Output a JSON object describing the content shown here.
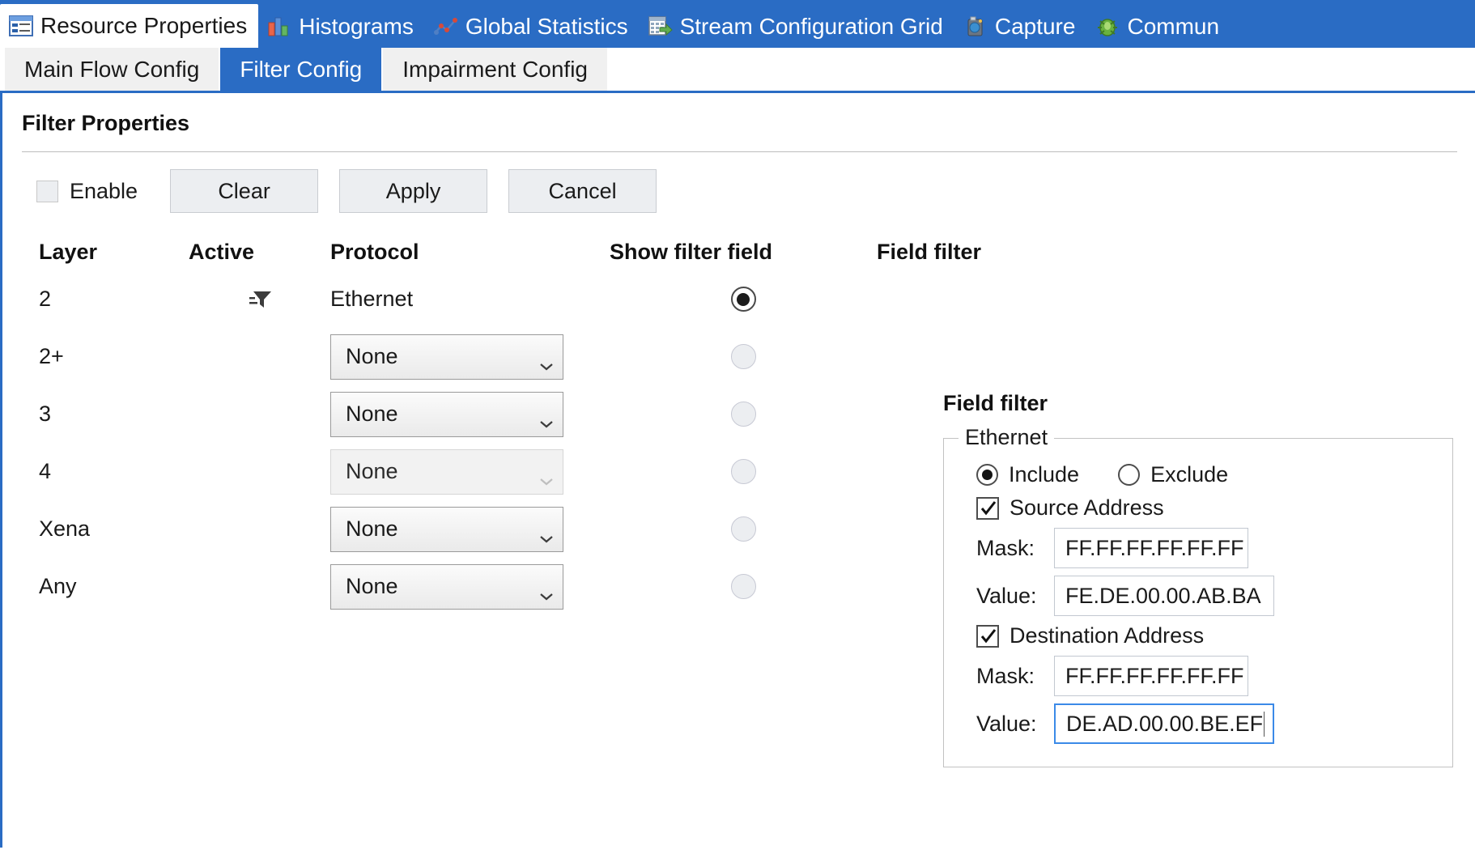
{
  "tabs": [
    {
      "label": "Resource Properties",
      "icon": "resource-properties-icon",
      "active": true
    },
    {
      "label": "Histograms",
      "icon": "histograms-icon",
      "active": false
    },
    {
      "label": "Global Statistics",
      "icon": "global-statistics-icon",
      "active": false
    },
    {
      "label": "Stream Configuration Grid",
      "icon": "stream-configuration-grid-icon",
      "active": false
    },
    {
      "label": "Capture",
      "icon": "capture-icon",
      "active": false
    },
    {
      "label": "Commun",
      "icon": "communication-icon",
      "active": false
    }
  ],
  "subtabs": [
    {
      "label": "Main Flow Config",
      "active": false
    },
    {
      "label": "Filter Config",
      "active": true
    },
    {
      "label": "Impairment Config",
      "active": false
    }
  ],
  "panel": {
    "title": "Filter Properties"
  },
  "toolbar": {
    "enable_label": "Enable",
    "enable_checked": false,
    "clear_label": "Clear",
    "apply_label": "Apply",
    "cancel_label": "Cancel"
  },
  "grid": {
    "headers": {
      "layer": "Layer",
      "active": "Active",
      "protocol": "Protocol",
      "show_filter_field": "Show filter field",
      "field_filter": "Field filter"
    },
    "rows": [
      {
        "layer": "2",
        "active_icon": "filter-funnel-icon",
        "protocol_text": "Ethernet",
        "protocol_type": "text",
        "disabled": false,
        "selected": true
      },
      {
        "layer": "2+",
        "active_icon": "",
        "protocol_text": "None",
        "protocol_type": "combo",
        "disabled": false,
        "selected": false
      },
      {
        "layer": "3",
        "active_icon": "",
        "protocol_text": "None",
        "protocol_type": "combo",
        "disabled": false,
        "selected": false
      },
      {
        "layer": "4",
        "active_icon": "",
        "protocol_text": "None",
        "protocol_type": "combo",
        "disabled": true,
        "selected": false
      },
      {
        "layer": "Xena",
        "active_icon": "",
        "protocol_text": "None",
        "protocol_type": "combo",
        "disabled": false,
        "selected": false
      },
      {
        "layer": "Any",
        "active_icon": "",
        "protocol_text": "None",
        "protocol_type": "combo",
        "disabled": false,
        "selected": false
      }
    ]
  },
  "field_filter": {
    "title": "Field filter",
    "group_legend": "Ethernet",
    "include_label": "Include",
    "exclude_label": "Exclude",
    "mode": "Include",
    "source": {
      "checkbox_label": "Source Address",
      "checked": true,
      "mask_label": "Mask:",
      "mask_value": "FF.FF.FF.FF.FF.FF",
      "value_label": "Value:",
      "value_value": "FE.DE.00.00.AB.BA"
    },
    "destination": {
      "checkbox_label": "Destination Address",
      "checked": true,
      "mask_label": "Mask:",
      "mask_value": "FF.FF.FF.FF.FF.FF",
      "value_label": "Value:",
      "value_value": "DE.AD.00.00.BE.EF",
      "value_focused": true
    }
  },
  "colors": {
    "accent": "#2a6cc4",
    "focus_border": "#3b8ae8",
    "button_face": "#eceef1",
    "panel_text": "#1a1a1a"
  }
}
